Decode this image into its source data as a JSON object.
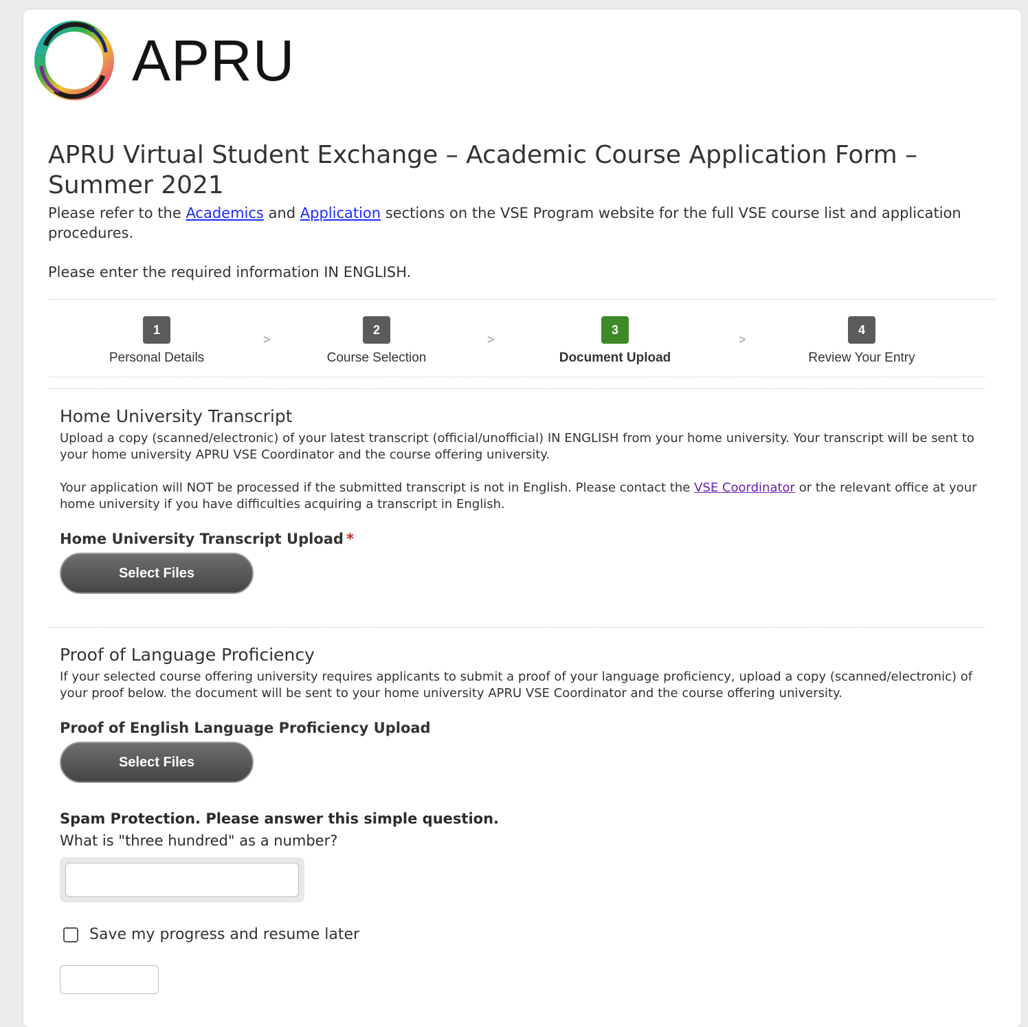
{
  "logo": {
    "text": "APRU"
  },
  "form": {
    "title": "APRU Virtual Student Exchange – Academic Course Application Form – Summer 2021",
    "intro_prefix": "Please refer to the ",
    "link_academics": "Academics",
    "intro_and": " and ",
    "link_application": "Application",
    "intro_suffix": " sections on the VSE Program website for the full VSE course list and application procedures.",
    "english_note": "Please enter the required information IN ENGLISH."
  },
  "steps": [
    {
      "number": "1",
      "label": "Personal Details"
    },
    {
      "number": "2",
      "label": "Course Selection"
    },
    {
      "number": "3",
      "label": "Document Upload"
    },
    {
      "number": "4",
      "label": "Review Your Entry"
    }
  ],
  "step_separator": ">",
  "transcript": {
    "heading": "Home University Transcript",
    "desc1": "Upload a copy (scanned/electronic) of your latest transcript (official/unofficial) IN ENGLISH from your home university. Your transcript will be sent to your home university APRU VSE Coordinator and the course offering university.",
    "desc2_prefix": "Your application will NOT be processed if the submitted transcript is not in English. Please contact the ",
    "desc2_link": "VSE Coordinator",
    "desc2_suffix": " or the relevant office at your home university if you have difficulties acquiring a transcript in English.",
    "upload_label": "Home University Transcript Upload",
    "required_mark": "*",
    "button": "Select Files"
  },
  "language": {
    "heading": "Proof of Language Proficiency",
    "desc": "If your selected course offering university requires applicants to submit a proof of your language proficiency, upload a copy (scanned/electronic) of your proof below. the document will be sent to your home university APRU VSE Coordinator and the course offering university.",
    "upload_label": "Proof of English Language Proficiency Upload",
    "button": "Select Files"
  },
  "spam": {
    "label": "Spam Protection. Please answer this simple question.",
    "question": "What is \"three hundred\" as a number?",
    "value": ""
  },
  "save": {
    "label": "Save my progress and resume later",
    "checked": false
  },
  "colors": {
    "active_step": "#3f8a28",
    "inactive_step": "#5b5b5b",
    "link": "#1a2cff",
    "visited_link": "#6a1fb2",
    "required": "#c0282a"
  }
}
